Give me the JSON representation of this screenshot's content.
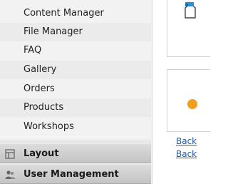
{
  "sidebar": {
    "sub_items": [
      {
        "label": "Content Manager"
      },
      {
        "label": "File Manager"
      },
      {
        "label": "FAQ"
      },
      {
        "label": "Gallery"
      },
      {
        "label": "Orders"
      },
      {
        "label": "Products"
      },
      {
        "label": "Workshops"
      }
    ],
    "sections": [
      {
        "label": "Layout",
        "icon": "layout-icon"
      },
      {
        "label": "User Management",
        "icon": "users-icon"
      }
    ]
  },
  "content": {
    "links": [
      {
        "label": "Back"
      },
      {
        "label": "Back"
      }
    ]
  },
  "colors": {
    "sidebar_bg": "#f2f2f2",
    "link": "#1e5fa8",
    "accent_orange": "#f0a020",
    "accent_blue": "#2a8fd0"
  }
}
